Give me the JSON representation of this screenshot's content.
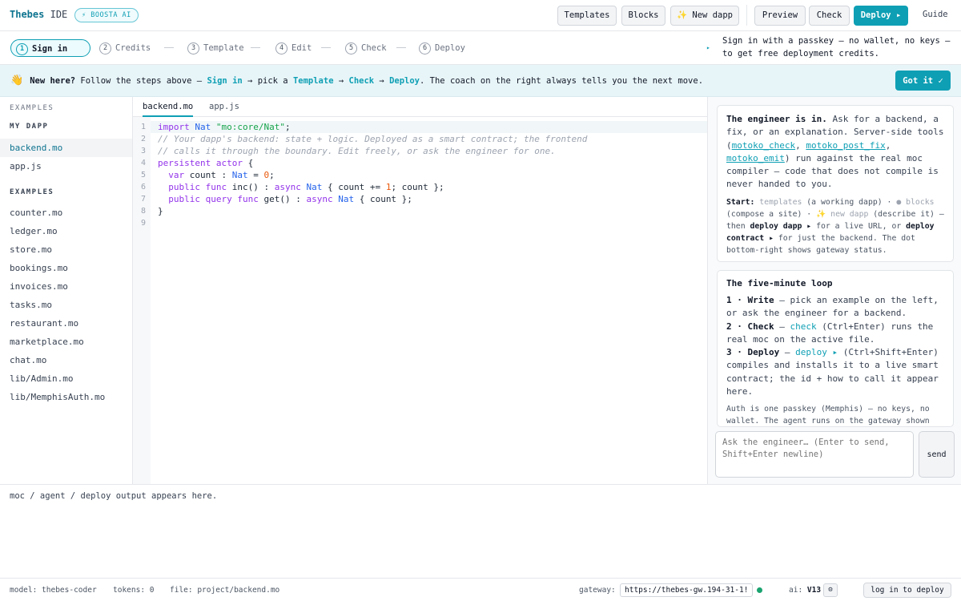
{
  "app": {
    "brand": "Thebes",
    "brand_suffix": "IDE",
    "badge": "⚡ BOOSTA AI"
  },
  "toolbar": {
    "templates": "Templates",
    "blocks": "Blocks",
    "new_dapp": "✨ New dapp",
    "preview": "Preview",
    "check": "Check",
    "deploy": "Deploy ▸",
    "guide": "Guide"
  },
  "steps": [
    {
      "num": "1",
      "label": "Sign in"
    },
    {
      "num": "2",
      "label": "Credits"
    },
    {
      "num": "3",
      "label": "Template"
    },
    {
      "num": "4",
      "label": "Edit"
    },
    {
      "num": "5",
      "label": "Check"
    },
    {
      "num": "6",
      "label": "Deploy"
    }
  ],
  "steps_arrow": "▸",
  "steps_hint": "Sign in with a passkey — no wallet, no keys — to get free deployment credits.",
  "banner": {
    "emoji": "👋",
    "lead": "New here?",
    "text1": " Follow the steps above — ",
    "signin": "Sign in",
    "arrow1": " → pick a ",
    "template": "Template",
    "arrow2": " → ",
    "check": "Check",
    "arrow3": " → ",
    "deploy": "Deploy",
    "text2": ". The coach on the right always tells you the next move.",
    "gotit": "Got it ✓"
  },
  "sidebar": {
    "top_heading": "EXAMPLES",
    "mydapp_heading": "MY DAPP",
    "mydapp_files": [
      "backend.mo",
      "app.js"
    ],
    "examples_heading": "EXAMPLES",
    "examples": [
      "counter.mo",
      "ledger.mo",
      "store.mo",
      "bookings.mo",
      "invoices.mo",
      "tasks.mo",
      "restaurant.mo",
      "marketplace.mo",
      "chat.mo",
      "lib/Admin.mo",
      "lib/MemphisAuth.mo"
    ]
  },
  "editor": {
    "tabs": [
      "backend.mo",
      "app.js"
    ],
    "line_numbers": [
      "1",
      "2",
      "3",
      "4",
      "5",
      "6",
      "7",
      "8",
      "9"
    ],
    "code": {
      "l1_kw": "import",
      "l1_ty": "Nat",
      "l1_str": "\"mo:core/Nat\"",
      "l1_end": ";",
      "l2": "// Your dapp's backend: state + logic. Deployed as a smart contract; the frontend",
      "l3": "// calls it through the boundary. Edit freely, or ask the engineer for one.",
      "l4_kw": "persistent actor",
      "l4_end": " {",
      "l5_kw": "  var",
      "l5_mid": " count : ",
      "l5_ty": "Nat",
      "l5_eq": " = ",
      "l5_num": "0",
      "l5_end": ";",
      "l6_kw": "  public func",
      "l6_mid": " inc() : ",
      "l6_kw2": "async",
      "l6_ty": " Nat",
      "l6_mid2": " { count += ",
      "l6_num": "1",
      "l6_end": "; count };",
      "l7_kw": "  public query func",
      "l7_mid": " get() : ",
      "l7_kw2": "async",
      "l7_ty": " Nat",
      "l7_end": " { count };",
      "l8": "}"
    }
  },
  "coach": {
    "card1": {
      "lead": "The engineer is in.",
      "text1": " Ask for a backend, a fix, or an explanation. Server-side tools (",
      "tool1": "motoko_check",
      "sep1": ", ",
      "tool2": "motoko_post_fix",
      "sep2": ", ",
      "tool3": "motoko_emit",
      "text2": ") run against the real moc compiler — code that does not compile is never handed to you.",
      "start": "Start:",
      "s1": " templates",
      "s2": " (a working dapp) · ",
      "s3": "● blocks",
      "s4": " (compose a site) · ",
      "s5": "✨ new dapp",
      "s6": " (describe it) — then ",
      "s7": "deploy dapp ▸",
      "s8": " for a live URL, or ",
      "s9": "deploy contract ▸",
      "s10": " for just the backend. The dot bottom-right shows gateway status."
    },
    "card2": {
      "title": "The five-minute loop",
      "i1_b": "1 · Write",
      "i1": " — pick an example on the left, or ask the engineer for a backend.",
      "i2_b": "2 · Check",
      "i2_a": " — ",
      "i2_lk": "check",
      "i2": " (Ctrl+Enter) runs the real moc on the active file.",
      "i3_b": "3 · Deploy",
      "i3_a": " — ",
      "i3_lk": "deploy ▸",
      "i3": " (Ctrl+Shift+Enter) compiles and installs it to a live smart contract; the id + how to call it appear here.",
      "note": "Auth is one passkey (Memphis) — no keys, no wallet. The agent runs on the gateway shown"
    },
    "ask_placeholder": "Ask the engineer… (Enter to send, Shift+Enter newline)",
    "send": "send"
  },
  "output": {
    "text": "moc / agent / deploy output appears here."
  },
  "status": {
    "model": "model: thebes-coder",
    "tokens": "tokens: 0",
    "file": "file: project/backend.mo",
    "gateway_label": "gateway:",
    "gateway_value": "https://thebes-gw.194-31-1!",
    "ai_label": "ai:",
    "ai_version": "V13",
    "ai_gear": "⚙",
    "login": "log in to deploy"
  },
  "colors": {
    "accent": "#0e9fb4",
    "gateway_ok": "#1aa36f",
    "banner_bg": "#e8f5f8"
  }
}
